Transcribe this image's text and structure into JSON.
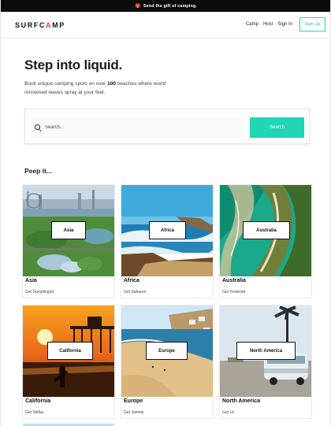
{
  "promo": {
    "text": "Send the gift of camping.",
    "icon": "gift-icon"
  },
  "brand": {
    "logo_part1": "SURFC",
    "logo_accent": "A",
    "logo_part2": "MP",
    "accent_color": "#e0463e",
    "theme_color": "#1fd6b5"
  },
  "nav": {
    "links": [
      "Camp",
      "Host",
      "Sign In"
    ],
    "signup_label": "Sign Up"
  },
  "hero": {
    "title": "Step into liquid.",
    "subtitle_pre": "Book unique camping spots on over ",
    "subtitle_bold": "100",
    "subtitle_post": " beaches where world renowned waves spray at your feet."
  },
  "search": {
    "placeholder": "Search...",
    "button_label": "Search",
    "icon": "search-icon"
  },
  "section": {
    "title": "Peep it..."
  },
  "destinations": [
    {
      "tag": "Asia",
      "name": "Asia",
      "cta": "Get Dumplinged"
    },
    {
      "tag": "Africa",
      "name": "Africa",
      "cta": "Get Saharan"
    },
    {
      "tag": "Australia",
      "name": "Australia",
      "cta": "Get Fostered"
    },
    {
      "tag": "California",
      "name": "California",
      "cta": "Get Stellar"
    },
    {
      "tag": "Europe",
      "name": "Europe",
      "cta": "Get Jammy"
    },
    {
      "tag": "North America",
      "name": "North America",
      "cta": "Get Lit"
    }
  ]
}
